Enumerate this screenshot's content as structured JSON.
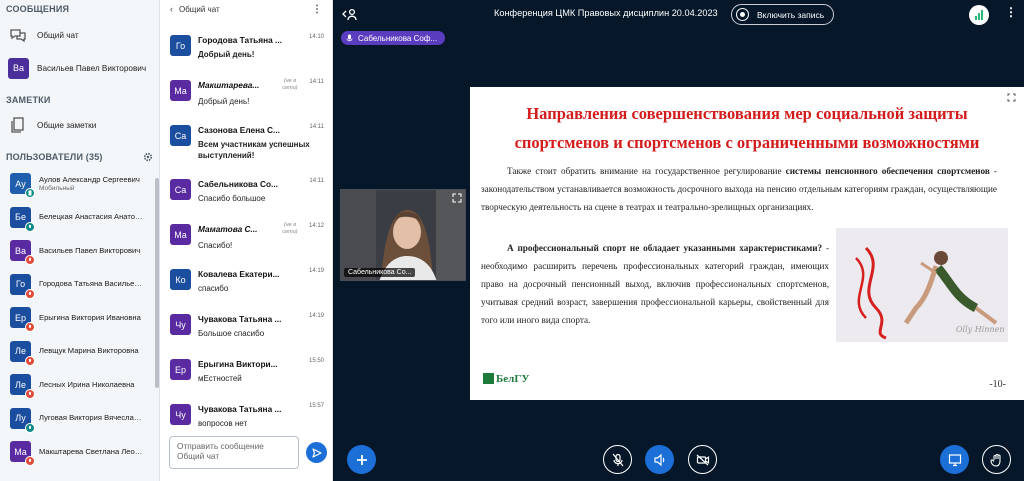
{
  "sidebar": {
    "messages_title": "СООБЩЕНИЯ",
    "public_chat": "Общий чат",
    "dm_initials": "Ва",
    "dm_name": "Васильев Павел Викторович",
    "notes_title": "ЗАМЕТКИ",
    "shared_notes": "Общие заметки",
    "users_title": "ПОЛЬЗОВАТЕЛИ (35)",
    "users": [
      {
        "initials": "Ау",
        "name": "Аулов Александр Сергеевич",
        "sub": "Мобильный"
      },
      {
        "initials": "Бе",
        "name": "Белецкая Анастасия Анатольевна"
      },
      {
        "initials": "Ва",
        "name": "Васильев Павел Викторович"
      },
      {
        "initials": "Го",
        "name": "Городова Татьяна Васильевна"
      },
      {
        "initials": "Ер",
        "name": "Ерыгина Виктория Ивановна"
      },
      {
        "initials": "Ле",
        "name": "Левщук Марина Викторовна"
      },
      {
        "initials": "Ле",
        "name": "Лесных Ирина Николаевна"
      },
      {
        "initials": "Лу",
        "name": "Луговая Виктория Вячеславовна"
      },
      {
        "initials": "Ма",
        "name": "Макштарева Светлана Леонидовна"
      }
    ]
  },
  "chat": {
    "title": "Общий чат",
    "offline_label": "(не в сети)",
    "messages": [
      {
        "initials": "Го",
        "author": "Городова Татьяна ...",
        "time": "14:10",
        "text": "Добрый день!",
        "bold": true
      },
      {
        "initials": "Ма",
        "author": "Макштарева...",
        "time": "14:11",
        "text": "Добрый день!",
        "offline": true
      },
      {
        "initials": "Са",
        "author": "Сазонова Елена С...",
        "time": "14:11",
        "text": "Всем участникам успешных выступлений!",
        "bold": true
      },
      {
        "initials": "Са",
        "author": "Сабельникова Со...",
        "time": "14:11",
        "text": "Спасибо большое"
      },
      {
        "initials": "Ма",
        "author": "Маматова С...",
        "time": "14:12",
        "text": "Спасибо!",
        "offline": true
      },
      {
        "initials": "Ко",
        "author": "Ковалева Екатери...",
        "time": "14:19",
        "text": "спасибо"
      },
      {
        "initials": "Чу",
        "author": "Чувакова Татьяна ...",
        "time": "14:19",
        "text": "Большое спасибо"
      },
      {
        "initials": "Ер",
        "author": "Ерыгина Виктори...",
        "time": "15:50",
        "text": "мЕстностей"
      },
      {
        "initials": "Чу",
        "author": "Чувакова Татьяна ...",
        "time": "15:57",
        "text": "вопросов нет"
      }
    ],
    "input_placeholder": "Отправить сообщение Общий чат"
  },
  "main": {
    "conference_title": "Конференция ЦМК Правовых дисциплин 20.04.2023",
    "record_label": "Включить запись",
    "speaker": "Сабельникова Соф...",
    "camera_name": "Сабельникова Со...",
    "slide": {
      "title_line1": "Направления совершенствования мер социальной защиты",
      "title_line2": "спортсменов и спортсменов с ограниченными возможностями",
      "p1_a": "Также стоит обратить внимание на государственное регулирование ",
      "p1_bold": "системы пенсионного обеспечения спортсменов",
      "p1_b": " - законодательством устанавливается возможность досрочного выхода на пенсию отдельным категориям граждан, осуществляющие творческую деятельность на сцене в театрах и театрально-зрелищных организациях.",
      "p2_bold": "А профессиональный спорт не обладает указанными характеристиками?",
      "p2_b": " - необходимо расширить перечень профессиональных категорий граждан, имеющих право на досрочный пенсионный выход, включив профессиональных спортсменов, учитывая средний возраст, завершения профессиональной карьеры, свойственный для того или иного вида спорта.",
      "photo_signature": "Olly Hinnen",
      "logo_text": "БелГУ",
      "page_number": "-10-"
    }
  },
  "colors": {
    "main_bg": "#06172a",
    "accent_blue": "#1b6fd6",
    "slide_title": "#d41c1c",
    "speaker_tag": "#5a3dbf"
  }
}
